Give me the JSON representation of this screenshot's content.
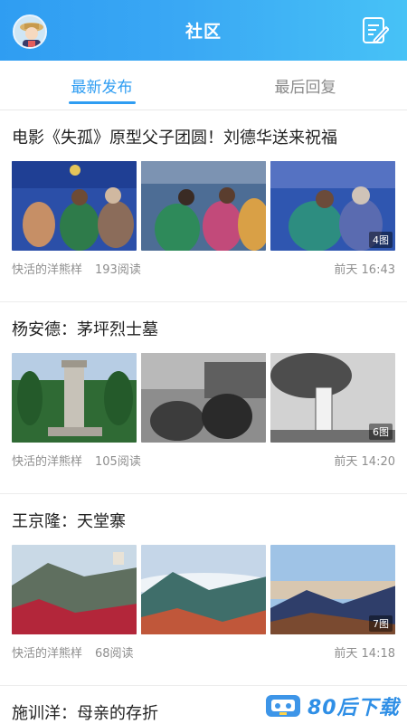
{
  "header": {
    "title": "社区",
    "avatar_icon": "user-avatar",
    "edit_icon": "edit-note-icon",
    "colors": {
      "start": "#2f9df2",
      "end": "#47c2f6"
    }
  },
  "tabs": [
    {
      "label": "最新发布",
      "active": true
    },
    {
      "label": "最后回复",
      "active": false
    }
  ],
  "posts": [
    {
      "title": "电影《失孤》原型父子团圆！刘德华送来祝福",
      "author": "快活的洋熊样",
      "reads": "193阅读",
      "time": "前天 16:43",
      "image_count": "4图"
    },
    {
      "title": "杨安德：茅坪烈士墓",
      "author": "快活的洋熊样",
      "reads": "105阅读",
      "time": "前天 14:20",
      "image_count": "6图"
    },
    {
      "title": "王京隆：天堂寨",
      "author": "快活的洋熊样",
      "reads": "68阅读",
      "time": "前天 14:18",
      "image_count": "7图"
    },
    {
      "title": "施训洋：母亲的存折"
    }
  ],
  "watermark": {
    "text": "80后下载"
  },
  "accent": "#2f9df2"
}
